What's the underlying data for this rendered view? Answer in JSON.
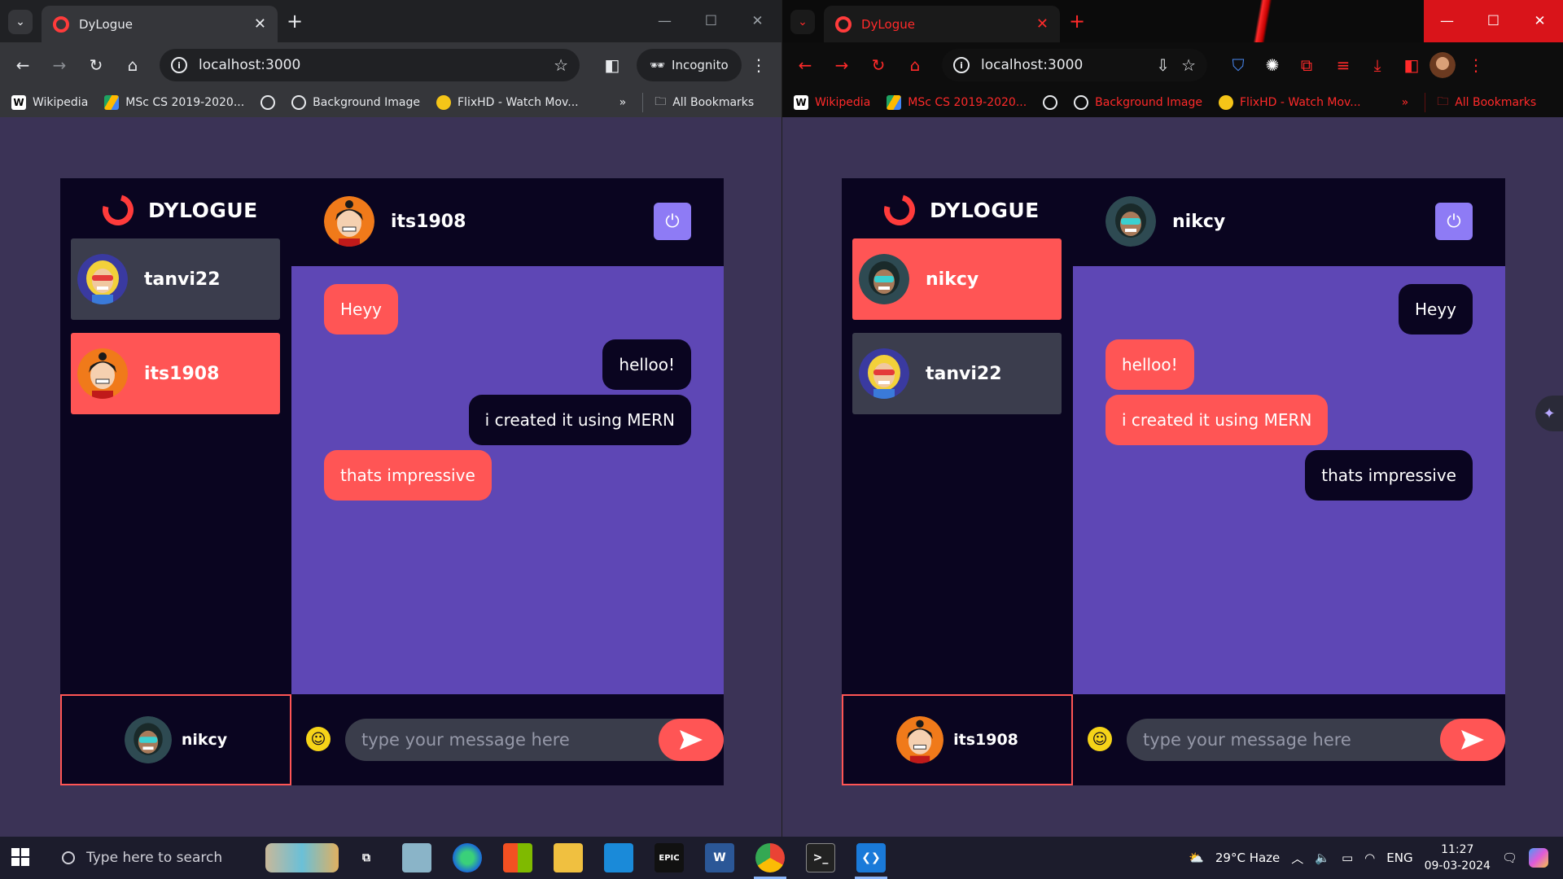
{
  "browser_left": {
    "tab_title": "DyLogue",
    "url": "localhost:3000",
    "incognito_label": "Incognito",
    "bookmarks": [
      {
        "label": "Wikipedia",
        "icon": "wikipedia-icon"
      },
      {
        "label": "MSc CS 2019-2020...",
        "icon": "drive-icon"
      },
      {
        "label": "",
        "icon": "globe-icon"
      },
      {
        "label": "Background Image",
        "icon": "globe-icon"
      },
      {
        "label": "FlixHD - Watch Mov...",
        "icon": "flixhd-icon"
      }
    ],
    "all_bookmarks": "All Bookmarks"
  },
  "browser_right": {
    "tab_title": "DyLogue",
    "url": "localhost:3000",
    "bookmarks": [
      {
        "label": "Wikipedia",
        "icon": "wikipedia-icon"
      },
      {
        "label": "MSc CS 2019-2020...",
        "icon": "drive-icon"
      },
      {
        "label": "",
        "icon": "globe-icon"
      },
      {
        "label": "Background Image",
        "icon": "globe-icon"
      },
      {
        "label": "FlixHD - Watch Mov...",
        "icon": "flixhd-icon"
      }
    ],
    "all_bookmarks": "All Bookmarks"
  },
  "app_left": {
    "brand": "DYLOGUE",
    "contacts": [
      {
        "name": "tanvi22",
        "active": false
      },
      {
        "name": "its1908",
        "active": true
      }
    ],
    "current_user": "nikcy",
    "chat_with": "its1908",
    "messages": [
      {
        "text": "Heyy",
        "side": "left"
      },
      {
        "text": "helloo!",
        "side": "right"
      },
      {
        "text": "i created it using MERN",
        "side": "right"
      },
      {
        "text": "thats impressive",
        "side": "left"
      }
    ],
    "input_placeholder": "type your message here"
  },
  "app_right": {
    "brand": "DYLOGUE",
    "contacts": [
      {
        "name": "nikcy",
        "active": true
      },
      {
        "name": "tanvi22",
        "active": false
      }
    ],
    "current_user": "its1908",
    "chat_with": "nikcy",
    "messages": [
      {
        "text": "Heyy",
        "side": "right"
      },
      {
        "text": "helloo!",
        "side": "left"
      },
      {
        "text": "i created it using MERN",
        "side": "left"
      },
      {
        "text": "thats impressive",
        "side": "right"
      }
    ],
    "input_placeholder": "type your message here"
  },
  "taskbar": {
    "search_placeholder": "Type here to search",
    "weather": "29°C  Haze",
    "language": "ENG",
    "time": "11:27",
    "date": "09-03-2024"
  },
  "colors": {
    "accent_red": "#ff5555",
    "chat_purple": "#5e47b5",
    "dark_navy": "#0a0520",
    "logout_purple": "#8e7bf5"
  }
}
